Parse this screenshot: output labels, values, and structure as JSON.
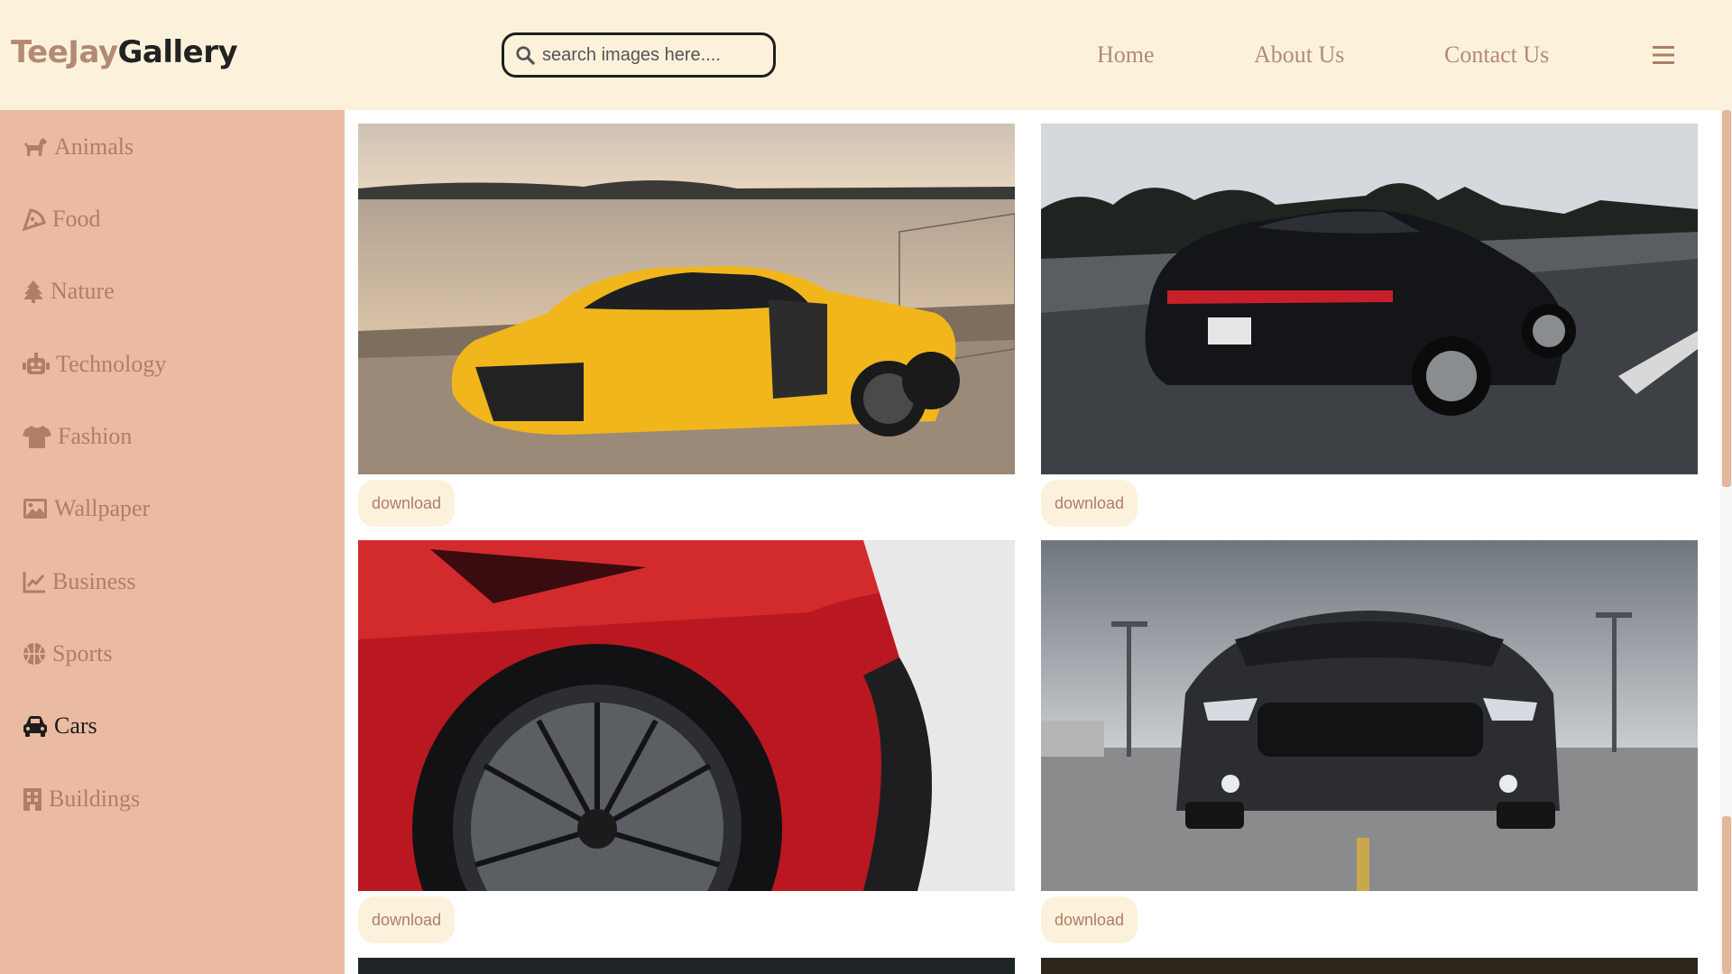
{
  "colors": {
    "header_bg": "#fcf2dc",
    "sidebar_bg": "#eabba0",
    "accent_text": "#b07d66",
    "active_text": "#1c1c1c",
    "download_bg": "#fcf2dc"
  },
  "header": {
    "brand_first": "TeeJay",
    "brand_second": "Gallery",
    "search_placeholder": "search images here....",
    "search_icon": "search-icon",
    "nav": [
      "Home",
      "About Us",
      "Contact Us"
    ],
    "menu_icon": "hamburger-menu-icon"
  },
  "sidebar": {
    "active": "Cars",
    "items": [
      {
        "label": "Animals",
        "icon": "dog-icon"
      },
      {
        "label": "Food",
        "icon": "pizza-icon"
      },
      {
        "label": "Nature",
        "icon": "tree-icon"
      },
      {
        "label": "Technology",
        "icon": "robot-icon"
      },
      {
        "label": "Fashion",
        "icon": "shirt-icon"
      },
      {
        "label": "Wallpaper",
        "icon": "image-icon"
      },
      {
        "label": "Business",
        "icon": "line-chart-icon"
      },
      {
        "label": "Sports",
        "icon": "basketball-icon"
      },
      {
        "label": "Cars",
        "icon": "car-icon"
      },
      {
        "label": "Buildings",
        "icon": "building-icon"
      }
    ]
  },
  "gallery": {
    "download_label": "download",
    "images": [
      {
        "subject": "yellow sports car by a lake"
      },
      {
        "subject": "black sedan on highway"
      },
      {
        "subject": "red supercar wheel close-up"
      },
      {
        "subject": "dark muscle car front view"
      }
    ]
  }
}
